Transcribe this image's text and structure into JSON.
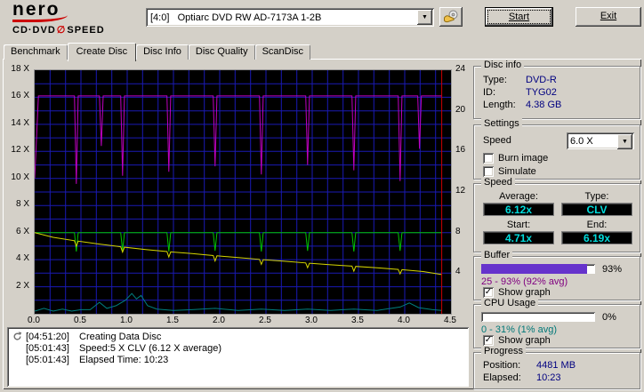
{
  "header": {
    "logo": {
      "name": "nero",
      "sub_left": "CD·DVD",
      "sub_right": "SPEED"
    },
    "drive": "[4:0]   Optiarc DVD RW AD-7173A 1-2B",
    "start_label": "Start",
    "exit_label": "Exit"
  },
  "icons": {
    "dropdown_arrow": "▼",
    "check": "✓",
    "disc": "∅"
  },
  "tabs": [
    {
      "label": "Benchmark"
    },
    {
      "label": "Create Disc"
    },
    {
      "label": "Disc Info"
    },
    {
      "label": "Disc Quality"
    },
    {
      "label": "ScanDisc"
    }
  ],
  "chart_data": {
    "type": "line",
    "x_axis": {
      "ticks": [
        0,
        0.5,
        1,
        1.5,
        2,
        2.5,
        3,
        3.5,
        4,
        4.5
      ],
      "max": 4.5
    },
    "left_axis": {
      "ticks": [
        18,
        16,
        14,
        12,
        10,
        8,
        6,
        4,
        2
      ],
      "suffix": " X",
      "max": 18
    },
    "right_axis": {
      "ticks": [
        24,
        20,
        16,
        12,
        8,
        4
      ],
      "max": 24
    },
    "grid": {
      "color": "#1a1ab4",
      "x_divisions": 27,
      "y_divisions": 18
    },
    "series": [
      {
        "name": "buffer-level",
        "color": "#c000c0",
        "points": [
          [
            0,
            10
          ],
          [
            0.04,
            16.1
          ],
          [
            0.43,
            16.1
          ],
          [
            0.45,
            9.6
          ],
          [
            0.47,
            16.1
          ],
          [
            0.7,
            16.1
          ],
          [
            0.72,
            12.4
          ],
          [
            0.74,
            16.1
          ],
          [
            0.93,
            16.1
          ],
          [
            0.95,
            10.2
          ],
          [
            0.97,
            16.1
          ],
          [
            1.43,
            16.1
          ],
          [
            1.45,
            10.5
          ],
          [
            1.47,
            16.1
          ],
          [
            1.93,
            16.1
          ],
          [
            1.95,
            10.9
          ],
          [
            1.97,
            16.1
          ],
          [
            2.43,
            16.1
          ],
          [
            2.45,
            10.3
          ],
          [
            2.47,
            16.1
          ],
          [
            2.93,
            16.1
          ],
          [
            2.95,
            11.0
          ],
          [
            2.97,
            16.1
          ],
          [
            3.43,
            16.1
          ],
          [
            3.45,
            10.6
          ],
          [
            3.47,
            16.1
          ],
          [
            3.93,
            16.1
          ],
          [
            3.95,
            9.8
          ],
          [
            3.97,
            16.1
          ],
          [
            4.14,
            16.1
          ],
          [
            4.16,
            12.2
          ],
          [
            4.18,
            16.1
          ],
          [
            4.4,
            16.1
          ]
        ]
      },
      {
        "name": "write-speed",
        "color": "#00c400",
        "points": [
          [
            0,
            6
          ],
          [
            0.43,
            6
          ],
          [
            0.45,
            4.6
          ],
          [
            0.47,
            6
          ],
          [
            0.93,
            6
          ],
          [
            0.95,
            4.65
          ],
          [
            0.97,
            6
          ],
          [
            1.43,
            6
          ],
          [
            1.45,
            4.6
          ],
          [
            1.47,
            6
          ],
          [
            1.93,
            6
          ],
          [
            1.95,
            4.65
          ],
          [
            1.97,
            6
          ],
          [
            2.43,
            6
          ],
          [
            2.45,
            4.6
          ],
          [
            2.47,
            6
          ],
          [
            2.93,
            6
          ],
          [
            2.95,
            4.65
          ],
          [
            2.97,
            6
          ],
          [
            3.43,
            6
          ],
          [
            3.45,
            4.6
          ],
          [
            3.47,
            6
          ],
          [
            3.93,
            6
          ],
          [
            3.95,
            4.65
          ],
          [
            3.97,
            6
          ],
          [
            4.4,
            6
          ]
        ]
      },
      {
        "name": "speed-trend",
        "color": "#d6d600",
        "points": [
          [
            0,
            6.0
          ],
          [
            0.2,
            5.65
          ],
          [
            0.43,
            5.4
          ],
          [
            0.45,
            5.0
          ],
          [
            0.47,
            5.37
          ],
          [
            0.7,
            5.15
          ],
          [
            0.93,
            4.95
          ],
          [
            0.95,
            4.55
          ],
          [
            0.97,
            4.92
          ],
          [
            1.2,
            4.75
          ],
          [
            1.43,
            4.6
          ],
          [
            1.45,
            4.2
          ],
          [
            1.47,
            4.57
          ],
          [
            1.7,
            4.45
          ],
          [
            1.93,
            4.3
          ],
          [
            1.95,
            3.9
          ],
          [
            1.97,
            4.28
          ],
          [
            2.2,
            4.15
          ],
          [
            2.43,
            4.02
          ],
          [
            2.45,
            3.65
          ],
          [
            2.47,
            4.0
          ],
          [
            2.7,
            3.88
          ],
          [
            2.93,
            3.76
          ],
          [
            2.95,
            3.4
          ],
          [
            2.97,
            3.74
          ],
          [
            3.2,
            3.62
          ],
          [
            3.43,
            3.52
          ],
          [
            3.45,
            3.15
          ],
          [
            3.47,
            3.5
          ],
          [
            3.7,
            3.4
          ],
          [
            3.93,
            3.28
          ],
          [
            3.95,
            2.95
          ],
          [
            3.97,
            3.26
          ],
          [
            4.2,
            3.12
          ],
          [
            4.4,
            2.9
          ]
        ]
      },
      {
        "name": "cpu-usage",
        "color": "#008080",
        "points": [
          [
            0,
            0.2
          ],
          [
            0.1,
            0.4
          ],
          [
            0.2,
            0.2
          ],
          [
            0.3,
            0.35
          ],
          [
            0.4,
            0.2
          ],
          [
            0.5,
            0.3
          ],
          [
            0.6,
            0.3
          ],
          [
            0.7,
            0.85
          ],
          [
            0.78,
            0.4
          ],
          [
            0.88,
            0.6
          ],
          [
            0.98,
            1.0
          ],
          [
            1.05,
            1.5
          ],
          [
            1.1,
            1.1
          ],
          [
            1.15,
            1.35
          ],
          [
            1.22,
            0.6
          ],
          [
            1.32,
            0.35
          ],
          [
            1.5,
            0.25
          ],
          [
            1.7,
            0.3
          ],
          [
            1.95,
            0.4
          ],
          [
            2.2,
            0.25
          ],
          [
            2.45,
            0.35
          ],
          [
            2.7,
            0.25
          ],
          [
            2.95,
            0.35
          ],
          [
            3.2,
            0.25
          ],
          [
            3.45,
            0.35
          ],
          [
            3.7,
            0.25
          ],
          [
            3.95,
            0.5
          ],
          [
            4.05,
            0.8
          ],
          [
            4.15,
            0.45
          ],
          [
            4.3,
            0.3
          ],
          [
            4.4,
            0.25
          ]
        ]
      }
    ],
    "marker": {
      "name": "current-position",
      "color": "#cc0000",
      "x": 4.4
    }
  },
  "panel": {
    "disc_info": {
      "title": "Disc info",
      "rows": [
        {
          "label": "Type:",
          "value": "DVD-R"
        },
        {
          "label": "ID:",
          "value": "TYG02"
        },
        {
          "label": "Length:",
          "value": "4.38 GB"
        }
      ]
    },
    "settings": {
      "title": "Settings",
      "speed_label": "Speed",
      "speed_value": "6.0 X",
      "burn_image": {
        "label": "Burn image",
        "checked": false
      },
      "simulate": {
        "label": "Simulate",
        "checked": false
      }
    },
    "speed": {
      "title": "Speed",
      "average_label": "Average:",
      "type_label": "Type:",
      "average_value": "6.12x",
      "type_value": "CLV",
      "start_label": "Start:",
      "end_label": "End:",
      "start_value": "4.71x",
      "end_value": "6.19x"
    },
    "buffer": {
      "title": "Buffer",
      "percent": 93,
      "percent_label": "93%",
      "range_text": "25 - 93% (92% avg)",
      "show_graph_label": "Show graph",
      "show_graph_checked": true
    },
    "cpu": {
      "title": "CPU Usage",
      "percent": 0,
      "percent_label": "0%",
      "range_text": "0 - 31% (1% avg)",
      "show_graph_label": "Show graph",
      "show_graph_checked": true
    },
    "progress": {
      "title": "Progress",
      "position_label": "Position:",
      "position_value": "4481 MB",
      "elapsed_label": "Elapsed:",
      "elapsed_value": "10:23"
    }
  },
  "log": {
    "lines": [
      {
        "time": "[04:51:20]",
        "text": "Creating Data Disc"
      },
      {
        "time": "[05:01:43]",
        "text": "Speed:5 X CLV (6.12 X average)"
      },
      {
        "time": "[05:01:43]",
        "text": "Elapsed Time: 10:23"
      }
    ]
  },
  "colors": {
    "window_bg": "#d4d0c8",
    "value_text": "#000080",
    "lcd_text": "#00dcdc",
    "buffer_bar": "#6633cc",
    "buffer_text": "#800080",
    "cpu_text": "#007878",
    "chart_bg": "#000000"
  }
}
